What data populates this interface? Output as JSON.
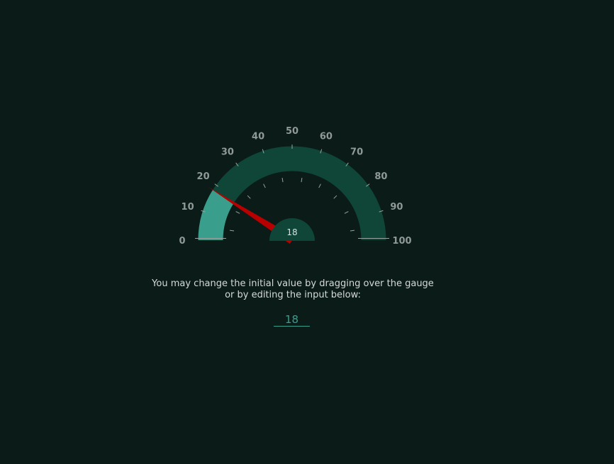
{
  "gauge": {
    "min": 0,
    "max": 100,
    "value": 18,
    "value_label": "18",
    "tick_labels": [
      "0",
      "10",
      "20",
      "30",
      "40",
      "50",
      "60",
      "70",
      "80",
      "90",
      "100"
    ],
    "colors": {
      "track": "#0f4637",
      "fill": "#3a9e8d",
      "needle": "#b80000",
      "hub": "#0f4637",
      "tick_label": "#8f9a97",
      "minor_tick": "#9aa5a2"
    }
  },
  "instructions": {
    "line1": "You may change the initial value by dragging over the gauge",
    "line2": "or by editing the input below:"
  },
  "input": {
    "value": "18"
  }
}
